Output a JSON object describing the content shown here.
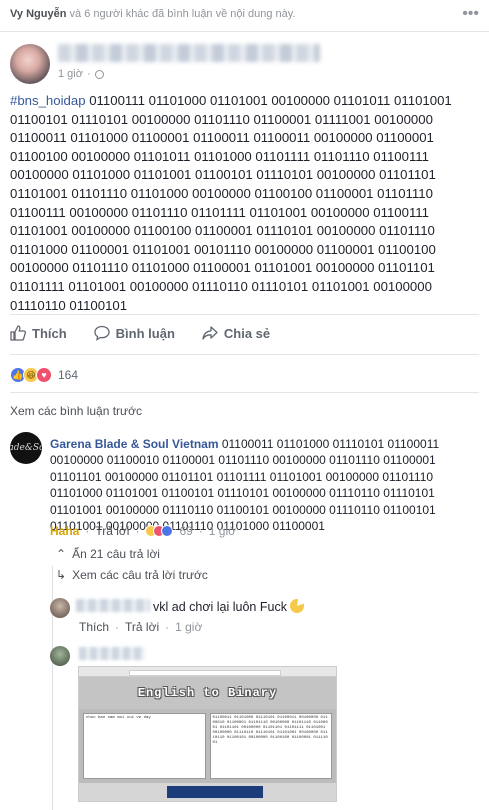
{
  "notice": {
    "actor": "Vy Nguyễn",
    "connector": "và",
    "others": "6 người khác",
    "rest": "đã bình luận về nội dung này.",
    "more": "•••"
  },
  "post": {
    "time": "1 giờ",
    "hashtag": "#bns_hoidap",
    "binary": " 01100111 01101000 01101001 00100000 01101011 01101001 01100101 01110101 00100000 01101110 01100001 01111001 00100000 01100011 01101000 01100001 01100011 01100011 00100000 01100001 01100100 00100000 01101011 01101000 01101111 01101110 01100111 00100000 01101000 01101001 01100101 01110101 00100000 01101101 01101001 01101110 01101000 00100000 01100100 01100001 01101110 01100111 00100000 01101110 01101111 01101001 00100000 01100111 01101001 00100000 01100100 01100001 01110101 00100000 01101110 01101000 01100001 01101001 00101110 00100000 01100001 01100100 00100000 01101110 01101000 01100001 01101001 00100000 01101101 01101111 01101001 00100000 01110110 01110101 01101001 00100000 01110110 01100101"
  },
  "actions": {
    "like": "Thích",
    "comment": "Bình luận",
    "share": "Chia sẻ"
  },
  "reactions": {
    "count": "164"
  },
  "comments": {
    "view_previous": "Xem các bình luận trước",
    "main": {
      "avatar_text": "Blade&Soul",
      "author": "Garena Blade & Soul Vietnam",
      "text": " 01100011 01101000 01110101 01100011 00100000 01100010 01100001 01101110 00100000 01101110 01100001 01101101 00100000 01101101 01101111 01101001 00100000 01101110 01101000 01101001 01100101 01110101 00100000 01110110 01110101 01101001 00100000 01110110 01100101 00100000 01110110 01100101 01101001 00100000 01101110 01101000 01100001",
      "reaction_label": "Haha",
      "reply": "Trả lời",
      "react_count": "69",
      "time": "1 giờ"
    },
    "hide_replies": "Ẩn 21 câu trả lời",
    "view_previous_replies": "Xem các câu trả lời trước",
    "reply1": {
      "text": "vkl ad chơi lại luôn Fuck",
      "like": "Thích",
      "reply": "Trả lời",
      "time": "1 giờ"
    },
    "screenshot": {
      "title": "English to Binary",
      "left_text": "chuc ban nam moi vui ve day",
      "right_text": "01100011 01101000 01110101 01100011 00100000 01100010 01100001 01101110 00100000 01101110 01100001 01101101 00100000 01101101 01101111 01101001 00100000 01110110 01110101 01101001 00100000 01110110 01100101 00100000 01100100 01100001 01111001"
    }
  },
  "colors": {
    "link": "#365899",
    "meta": "#90949c",
    "haha": "#d9a400",
    "like_blue": "#4a76e8",
    "love_red": "#f0516d"
  }
}
